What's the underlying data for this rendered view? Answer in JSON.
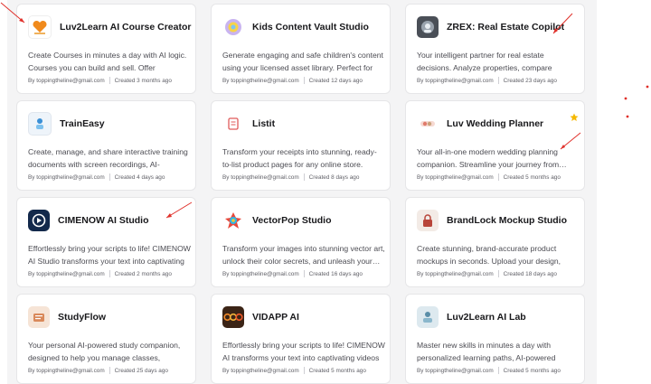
{
  "colors": {
    "annotation_red": "#e0302a",
    "star_gold": "#f5b800",
    "panel_bg": "#f4f4f5"
  },
  "cards": [
    {
      "title": "Luv2Learn AI Course Creator",
      "logo_icon": "luv2learn-logo-icon",
      "desc": "Create Courses in minutes a day with AI logic. Courses you can build and sell. Offer personalized…",
      "author": "By toppingtheline@gmail.com",
      "created": "Created 3 months ago"
    },
    {
      "title": "Kids Content Vault Studio",
      "logo_icon": "kids-vault-logo-icon",
      "desc": "Generate engaging and safe children's content using your licensed asset library. Perfect for paren…",
      "author": "By toppingtheline@gmail.com",
      "created": "Created 12 days ago"
    },
    {
      "title": "ZREX: Real Estate Copilot",
      "logo_icon": "zrex-logo-icon",
      "desc": "Your intelligent partner for real estate decisions. Analyze properties, compare investments, and…",
      "author": "By toppingtheline@gmail.com",
      "created": "Created 23 days ago"
    },
    {
      "title": "TrainEasy",
      "logo_icon": "traineasy-logo-icon",
      "desc": "Create, manage, and share interactive training documents with screen recordings, AI-powered…",
      "author": "By toppingtheline@gmail.com",
      "created": "Created 4 days ago"
    },
    {
      "title": "Listit",
      "logo_icon": "listit-logo-icon",
      "desc": "Transform your receipts into stunning, ready-to-list product pages for any online store. Effortlessly…",
      "author": "By toppingtheline@gmail.com",
      "created": "Created 8 days ago"
    },
    {
      "title": "Luv Wedding Planner",
      "logo_icon": "wedding-planner-logo-icon",
      "desc": "Your all-in-one modern wedding planning companion. Streamline your journey from…",
      "author": "By toppingtheline@gmail.com",
      "created": "Created 5 months ago",
      "starred": true
    },
    {
      "title": "CIMENOW AI Studio",
      "logo_icon": "cimenow-logo-icon",
      "desc": "Effortlessly bring your scripts to life! CIMENOW AI Studio transforms your text into captivating video…",
      "author": "By toppingtheline@gmail.com",
      "created": "Created 2 months ago"
    },
    {
      "title": "VectorPop Studio",
      "logo_icon": "vectorpop-logo-icon",
      "desc": "Transform your images into stunning vector art, unlock their color secrets, and unleash your…",
      "author": "By toppingtheline@gmail.com",
      "created": "Created 16 days ago"
    },
    {
      "title": "BrandLock Mockup Studio",
      "logo_icon": "brandlock-logo-icon",
      "desc": "Create stunning, brand-accurate product mockups in seconds. Upload your design, choose a style, an…",
      "author": "By toppingtheline@gmail.com",
      "created": "Created 18 days ago"
    },
    {
      "title": "StudyFlow",
      "logo_icon": "studyflow-logo-icon",
      "desc": "Your personal AI-powered study companion, designed to help you manage classes, homework,…",
      "author": "By toppingtheline@gmail.com",
      "created": "Created 25 days ago"
    },
    {
      "title": "VIDAPP AI",
      "logo_icon": "vidapp-logo-icon",
      "desc": "Effortlessly bring your scripts to life! CIMENOW AI transforms your text into captivating videos with…",
      "author": "By toppingtheline@gmail.com",
      "created": "Created 5 months ago"
    },
    {
      "title": "Luv2Learn AI Lab",
      "logo_icon": "luv2learn-lab-logo-icon",
      "desc": "Master new skills in minutes a day with personalized learning paths, AI-powered tutoring,…",
      "author": "By toppingtheline@gmail.com",
      "created": "Created 5 months ago"
    }
  ]
}
